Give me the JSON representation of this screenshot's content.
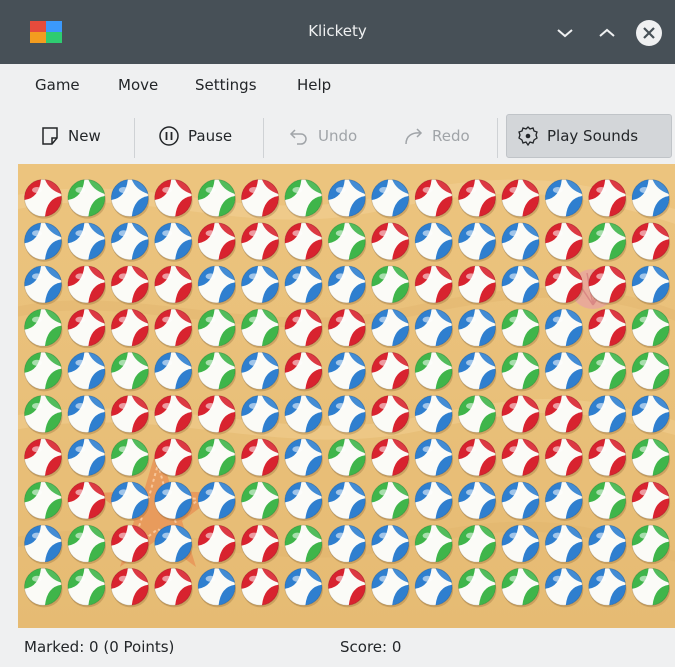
{
  "window": {
    "title": "Klickety"
  },
  "menu": [
    "Game",
    "Move",
    "Settings",
    "Help"
  ],
  "toolbar": {
    "new_label": "New",
    "pause_label": "Pause",
    "undo_label": "Undo",
    "redo_label": "Redo",
    "sounds_label": "Play Sounds"
  },
  "status": {
    "marked": "Marked: 0 (0 Points)",
    "score": "Score: 0"
  },
  "colors": {
    "red": "#d8232f",
    "green": "#3fb54a",
    "blue": "#2f7fcf",
    "titlebar": "#475057",
    "sand": "#ebc27c"
  },
  "board": {
    "rows": 10,
    "cols": 15,
    "legend": {
      "r": "red",
      "g": "green",
      "b": "blue"
    },
    "grid": [
      "rgbrgrgbbrrrbrb",
      "bbbbrrrgrbbbrgr",
      "brrrbbbbgrrbrrb",
      "grrrggrrbbbgbrg",
      "gbgbgbrbrgbgbgg",
      "gbrrrbbbrbgrrbb",
      "rbgrgrbgrbrrrrg",
      "grbbbgbbgbbbbgr",
      "bgrbrrgbbggbbbg",
      "ggrrbrbrbbggbbg"
    ]
  }
}
